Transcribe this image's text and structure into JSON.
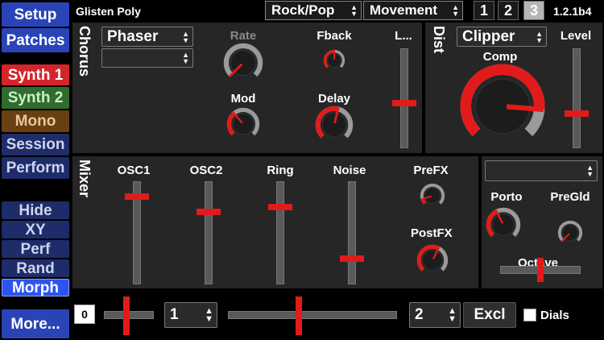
{
  "header": {
    "preset_name": "Glisten Poly",
    "category": "Rock/Pop",
    "subcategory": "Movement",
    "pages": [
      "1",
      "2",
      "3"
    ],
    "active_page": "3",
    "version": "1.2.1b4"
  },
  "sidebar": {
    "top": [
      "Setup",
      "Patches"
    ],
    "modes": [
      "Synth 1",
      "Synth 2",
      "Mono",
      "Session",
      "Perform"
    ],
    "active_mode": "Synth 1",
    "bottom": [
      "Hide",
      "XY",
      "Perf",
      "Rand",
      "Morph"
    ],
    "active_bottom": "Morph",
    "more": "More..."
  },
  "chorus": {
    "title": "Chorus",
    "type": "Phaser",
    "sub_type": "",
    "knobs": [
      {
        "label": "Rate",
        "value": 0.0,
        "disabled": true
      },
      {
        "label": "Fback",
        "value": 0.5
      },
      {
        "label": "Mod",
        "value": 0.35
      },
      {
        "label": "Delay",
        "value": 0.55
      }
    ],
    "level_label": "L...",
    "level_value": 0.45
  },
  "dist": {
    "title": "Dist",
    "type": "Clipper",
    "comp_label": "Comp",
    "comp_value": 0.85,
    "level_label": "Level",
    "level_value": 0.35
  },
  "mixer": {
    "title": "Mixer",
    "faders": [
      {
        "label": "OSC1",
        "value": 0.85
      },
      {
        "label": "OSC2",
        "value": 0.7
      },
      {
        "label": "Ring",
        "value": 0.75
      },
      {
        "label": "Noise",
        "value": 0.25
      }
    ],
    "prefx": {
      "label": "PreFX",
      "value": 0.1
    },
    "postfx": {
      "label": "PostFX",
      "value": 0.6
    }
  },
  "glide": {
    "select": "",
    "porto_label": "Porto",
    "porto_value": 0.4,
    "pregld_label": "PreGld",
    "pregld_value": 0.0,
    "octave_label": "Octave",
    "octave_value": 0.5
  },
  "footer": {
    "value_box": "0",
    "slider1_value": 0.45,
    "select1": "1",
    "slider2_value": 0.42,
    "select2": "2",
    "excl_label": "Excl",
    "dials_label": "Dials",
    "dials_checked": false
  },
  "colors": {
    "accent": "#e11b1b",
    "panel": "#262626",
    "sidebar_blue": "#2a44b8"
  }
}
